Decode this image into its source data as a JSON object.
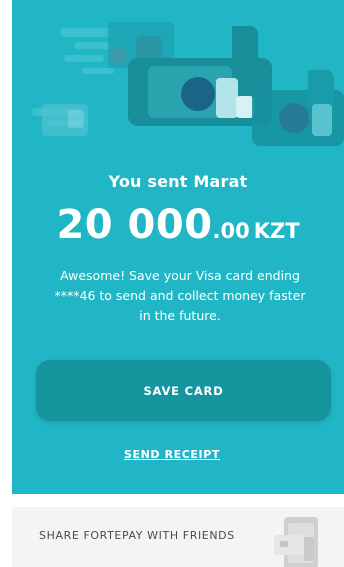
{
  "transfer": {
    "title": "You sent Marat",
    "amount_int": "20 000",
    "amount_dec": ".00",
    "currency": "KZT",
    "message": "Awesome! Save your Visa card ending ****46 to send and collect money faster in the future."
  },
  "actions": {
    "save_card_label": "SAVE CARD",
    "send_receipt_label": "SEND RECEIPT"
  },
  "share": {
    "label": "SHARE FORTEPAY WITH FRIENDS",
    "icon": "phone-share-icon"
  },
  "illustration": {
    "icon": "flying-cards-illustration"
  },
  "colors": {
    "teal": "#21b6c5",
    "button": "#17959f",
    "share_bg": "#f4f4f4",
    "share_text": "#4a4a4a"
  }
}
